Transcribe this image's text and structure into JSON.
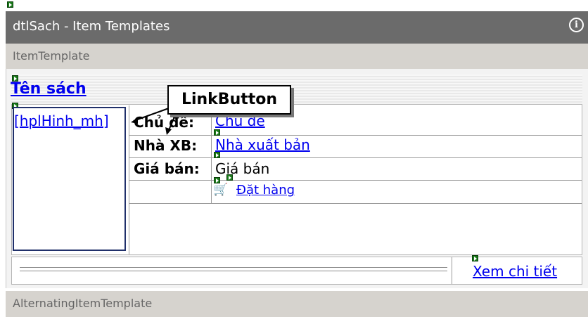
{
  "window": {
    "title": "dtlSach - Item Templates",
    "info_icon": "info-icon"
  },
  "sections": {
    "item_template": "ItemTemplate",
    "alternating_item_template": "AlternatingItemTemplate"
  },
  "template": {
    "title_link": "Tên sách",
    "image_link": "[hplHinh_mh]",
    "rows": [
      {
        "label": "Chủ đề:",
        "value": "Chủ đề"
      },
      {
        "label": "Nhà XB:",
        "value": "Nhà xuất bản"
      },
      {
        "label": "Giá bán:",
        "value": "Giá bán"
      }
    ],
    "order_link": "Đặt hàng",
    "detail_link": "Xem chi tiết"
  },
  "callout": {
    "text": "LinkButton"
  },
  "colors": {
    "titlebar": "#6b6b6b",
    "section": "#d6d3ce",
    "link": "#0000ee",
    "image_border": "#20306a"
  }
}
